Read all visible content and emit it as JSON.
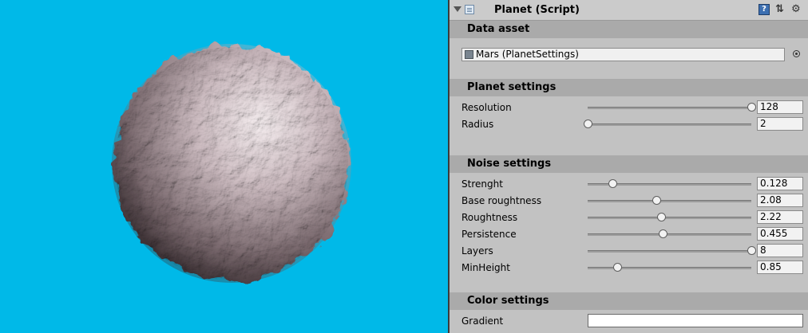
{
  "component": {
    "title": "Planet (Script)",
    "icon": "script-icon",
    "header_icons": [
      "help-icon",
      "preset-icon",
      "gear-icon"
    ]
  },
  "data_asset": {
    "section_title": "Data asset",
    "value": "Mars (PlanetSettings)"
  },
  "planet_settings": {
    "section_title": "Planet settings",
    "fields": [
      {
        "label": "Resolution",
        "value": "128",
        "slider_fraction": 1.0
      },
      {
        "label": "Radius",
        "value": "2",
        "slider_fraction": 0.0
      }
    ]
  },
  "noise_settings": {
    "section_title": "Noise settings",
    "fields": [
      {
        "label": "Strenght",
        "value": "0.128",
        "slider_fraction": 0.15
      },
      {
        "label": "Base roughtness",
        "value": "2.08",
        "slider_fraction": 0.42
      },
      {
        "label": "Roughtness",
        "value": "2.22",
        "slider_fraction": 0.45
      },
      {
        "label": "Persistence",
        "value": "0.455",
        "slider_fraction": 0.46
      },
      {
        "label": "Layers",
        "value": "8",
        "slider_fraction": 1.0
      },
      {
        "label": "MinHeight",
        "value": "0.85",
        "slider_fraction": 0.18
      }
    ]
  },
  "color_settings": {
    "section_title": "Color settings",
    "gradient_label": "Gradient",
    "gradient_color": "#ffffff"
  },
  "scene": {
    "background_color": "#00b9e8",
    "planet_color": "#d8c8cc"
  }
}
